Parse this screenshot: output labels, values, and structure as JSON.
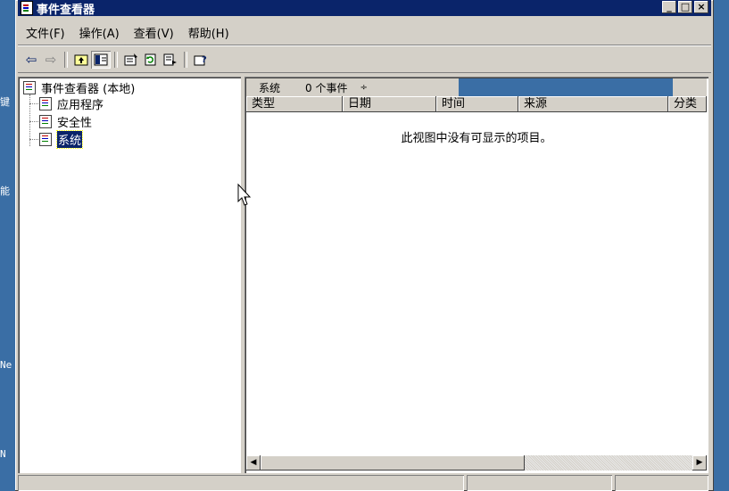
{
  "desktop": {
    "side_labels": [
      "键",
      "能",
      "Ne",
      "N"
    ]
  },
  "window": {
    "title": "事件查看器",
    "controls": {
      "minimize": "_",
      "maximize": "□",
      "close": "×"
    }
  },
  "menubar": {
    "items": [
      "文件(F)",
      "操作(A)",
      "查看(V)",
      "帮助(H)"
    ]
  },
  "toolbar": {
    "icons": [
      "back-arrow-icon",
      "forward-arrow-icon",
      "up-folder-icon",
      "show-hide-tree-icon",
      "properties-icon",
      "refresh-icon",
      "export-list-icon",
      "help-icon"
    ]
  },
  "tree": {
    "root": "事件查看器 (本地)",
    "items": [
      "应用程序",
      "安全性",
      "系统"
    ],
    "selected": "系统"
  },
  "list": {
    "log_name": "系统",
    "event_count": "0 个事件",
    "sort_indicator": "÷",
    "columns": [
      "类型",
      "日期",
      "时间",
      "来源",
      "分类"
    ],
    "empty_message": "此视图中没有可显示的项目。"
  },
  "colors": {
    "titlebar": "#0a246a",
    "face": "#d4d0c8",
    "desktop": "#3a6ea5",
    "selection": "#0a246a"
  }
}
